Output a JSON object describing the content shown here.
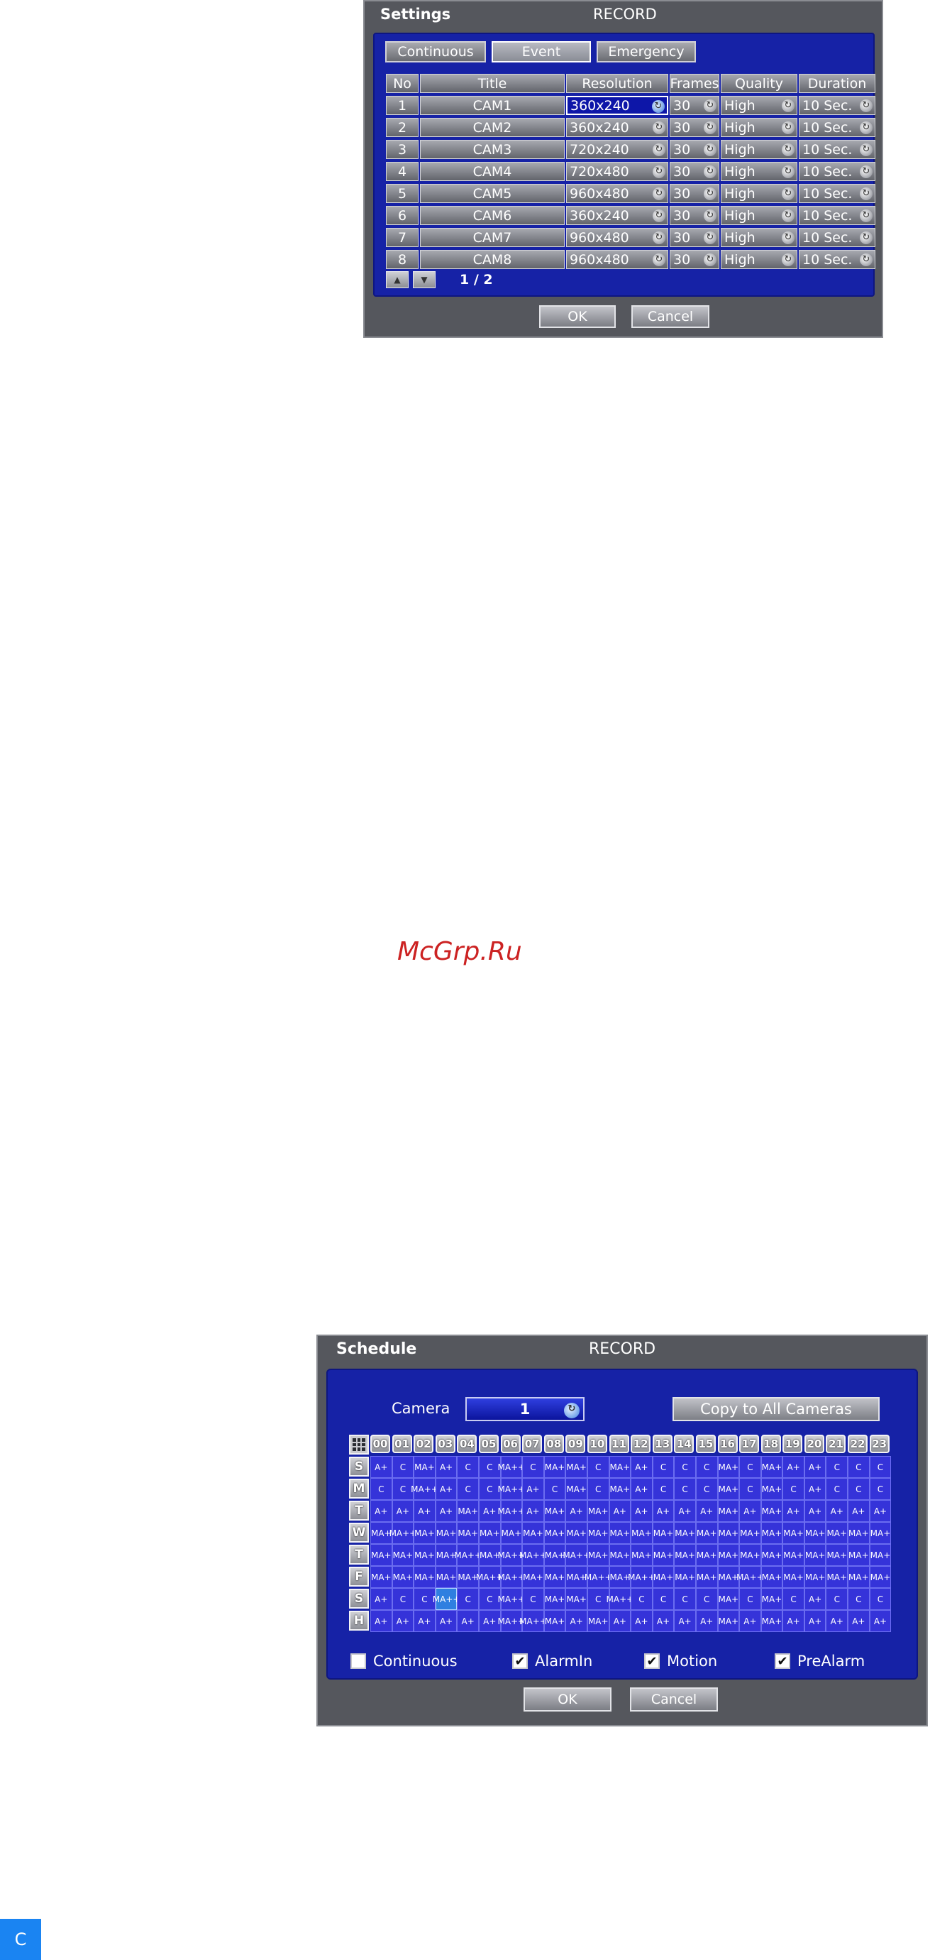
{
  "settings": {
    "title": "Settings",
    "section": "RECORD",
    "tabs": [
      "Continuous",
      "Event",
      "Emergency"
    ],
    "active_tab": "Event",
    "columns": [
      "No",
      "Title",
      "Resolution",
      "Frames",
      "Quality",
      "Duration"
    ],
    "rows": [
      {
        "no": "1",
        "title": "CAM1",
        "resolution": "360x240",
        "frames": "30",
        "quality": "High",
        "duration": "10 Sec."
      },
      {
        "no": "2",
        "title": "CAM2",
        "resolution": "360x240",
        "frames": "30",
        "quality": "High",
        "duration": "10 Sec."
      },
      {
        "no": "3",
        "title": "CAM3",
        "resolution": "720x240",
        "frames": "30",
        "quality": "High",
        "duration": "10 Sec."
      },
      {
        "no": "4",
        "title": "CAM4",
        "resolution": "720x480",
        "frames": "30",
        "quality": "High",
        "duration": "10 Sec."
      },
      {
        "no": "5",
        "title": "CAM5",
        "resolution": "960x480",
        "frames": "30",
        "quality": "High",
        "duration": "10 Sec."
      },
      {
        "no": "6",
        "title": "CAM6",
        "resolution": "360x240",
        "frames": "30",
        "quality": "High",
        "duration": "10 Sec."
      },
      {
        "no": "7",
        "title": "CAM7",
        "resolution": "960x480",
        "frames": "30",
        "quality": "High",
        "duration": "10 Sec."
      },
      {
        "no": "8",
        "title": "CAM8",
        "resolution": "960x480",
        "frames": "30",
        "quality": "High",
        "duration": "10 Sec."
      }
    ],
    "page_indicator": "1 / 2",
    "ok_label": "OK",
    "cancel_label": "Cancel"
  },
  "watermark": "McGrp.Ru",
  "schedule": {
    "title": "Schedule",
    "section": "RECORD",
    "camera_label": "Camera",
    "camera_value": "1",
    "copy_label": "Copy to All Cameras",
    "hours": [
      "00",
      "01",
      "02",
      "03",
      "04",
      "05",
      "06",
      "07",
      "08",
      "09",
      "10",
      "11",
      "12",
      "13",
      "14",
      "15",
      "16",
      "17",
      "18",
      "19",
      "20",
      "21",
      "22",
      "23"
    ],
    "days": [
      "S",
      "M",
      "T",
      "W",
      "T",
      "F",
      "S",
      "H"
    ],
    "grid": [
      [
        "A+",
        "C",
        "MA+",
        "A+",
        "C",
        "C",
        "MA++",
        "C",
        "MA+",
        "MA+",
        "C",
        "MA+",
        "A+",
        "C",
        "C",
        "C",
        "MA+",
        "C",
        "MA+",
        "A+",
        "A+",
        "C",
        "C",
        "C"
      ],
      [
        "C",
        "C",
        "MA++",
        "A+",
        "C",
        "C",
        "MA++",
        "A+",
        "C",
        "MA+",
        "C",
        "MA+",
        "A+",
        "C",
        "C",
        "C",
        "MA+",
        "C",
        "MA+",
        "C",
        "A+",
        "C",
        "C",
        "C"
      ],
      [
        "A+",
        "A+",
        "A+",
        "A+",
        "MA+",
        "A+",
        "MA++",
        "A+",
        "MA+",
        "A+",
        "MA+",
        "A+",
        "A+",
        "A+",
        "A+",
        "A+",
        "MA+",
        "A+",
        "MA+",
        "A+",
        "A+",
        "A+",
        "A+",
        "A+"
      ],
      [
        "MA+",
        "MA++",
        "MA+",
        "MA+",
        "MA+",
        "MA+",
        "MA+",
        "MA+",
        "MA+",
        "MA+",
        "MA+",
        "MA+",
        "MA+",
        "MA+",
        "MA+",
        "MA+",
        "MA+",
        "MA+",
        "MA+",
        "MA+",
        "MA+",
        "MA+",
        "MA+",
        "MA+"
      ],
      [
        "MA+",
        "MA+",
        "MA+",
        "MA+",
        "MA++",
        "MA+",
        "MA++",
        "MA++",
        "MA+",
        "MA++",
        "MA+",
        "MA+",
        "MA+",
        "MA+",
        "MA+",
        "MA+",
        "MA+",
        "MA+",
        "MA+",
        "MA+",
        "MA+",
        "MA+",
        "MA+",
        "MA+"
      ],
      [
        "MA+",
        "MA+",
        "MA+",
        "MA+",
        "MA+",
        "MA++",
        "MA++",
        "MA+",
        "MA+",
        "MA+",
        "MA++",
        "MA+",
        "MA++",
        "MA+",
        "MA+",
        "MA+",
        "MA+",
        "MA++",
        "MA+",
        "MA+",
        "MA+",
        "MA+",
        "MA+",
        "MA+"
      ],
      [
        "A+",
        "C",
        "C",
        "MA++",
        "C",
        "C",
        "MA++",
        "C",
        "MA+",
        "MA+",
        "C",
        "MA++",
        "C",
        "C",
        "C",
        "C",
        "MA+",
        "C",
        "MA+",
        "C",
        "A+",
        "C",
        "C",
        "C"
      ],
      [
        "A+",
        "A+",
        "A+",
        "A+",
        "A+",
        "A+",
        "MA++",
        "MA++",
        "MA+",
        "A+",
        "MA+",
        "A+",
        "A+",
        "A+",
        "A+",
        "A+",
        "MA+",
        "A+",
        "MA+",
        "A+",
        "A+",
        "A+",
        "A+",
        "A+"
      ]
    ],
    "selected_cell": "S-03",
    "legend": [
      {
        "label": "Continuous",
        "checked": false
      },
      {
        "label": "AlarmIn",
        "checked": true
      },
      {
        "label": "Motion",
        "checked": true
      },
      {
        "label": "PreAlarm",
        "checked": true
      }
    ],
    "ok_label": "OK",
    "cancel_label": "Cancel"
  },
  "corner_tab": "C",
  "colors": {
    "panel_blue": "#1622a6",
    "slot_blue": "#3533d9",
    "dialog_gray": "#55575d",
    "watermark_red": "#cc2222",
    "corner_blue": "#1a84f2"
  }
}
